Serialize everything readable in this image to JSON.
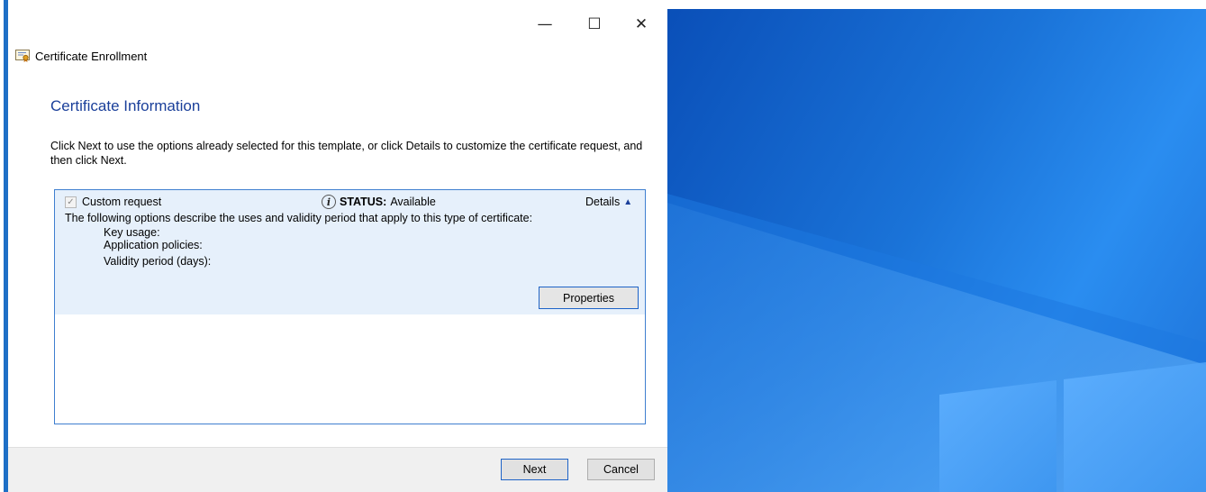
{
  "window": {
    "title": "Certificate Enrollment",
    "minimize_glyph": "—",
    "maximize_glyph": "☐",
    "close_glyph": "✕"
  },
  "page": {
    "title": "Certificate Information",
    "instructions": "Click Next to use the options already selected for this template, or click Details to customize the certificate request, and then click Next."
  },
  "template_item": {
    "name": "Custom request",
    "checked": true,
    "status_label": "STATUS:",
    "status_value": "Available",
    "details_label": "Details",
    "description": "The following options describe the uses and validity period that apply to this type of certificate:",
    "fields": [
      "Key usage:",
      "Application policies:",
      "Validity period (days):"
    ],
    "properties_label": "Properties"
  },
  "footer": {
    "next_label": "Next",
    "cancel_label": "Cancel"
  },
  "icons": {
    "title_icon": "certificate-icon",
    "status_icon": "info-icon",
    "details_toggle": "chevron-up-icon"
  },
  "colors": {
    "accent": "#1a3f9a",
    "selection_bg": "#e6f0fb",
    "desktop_blue": "#1a73d8"
  }
}
